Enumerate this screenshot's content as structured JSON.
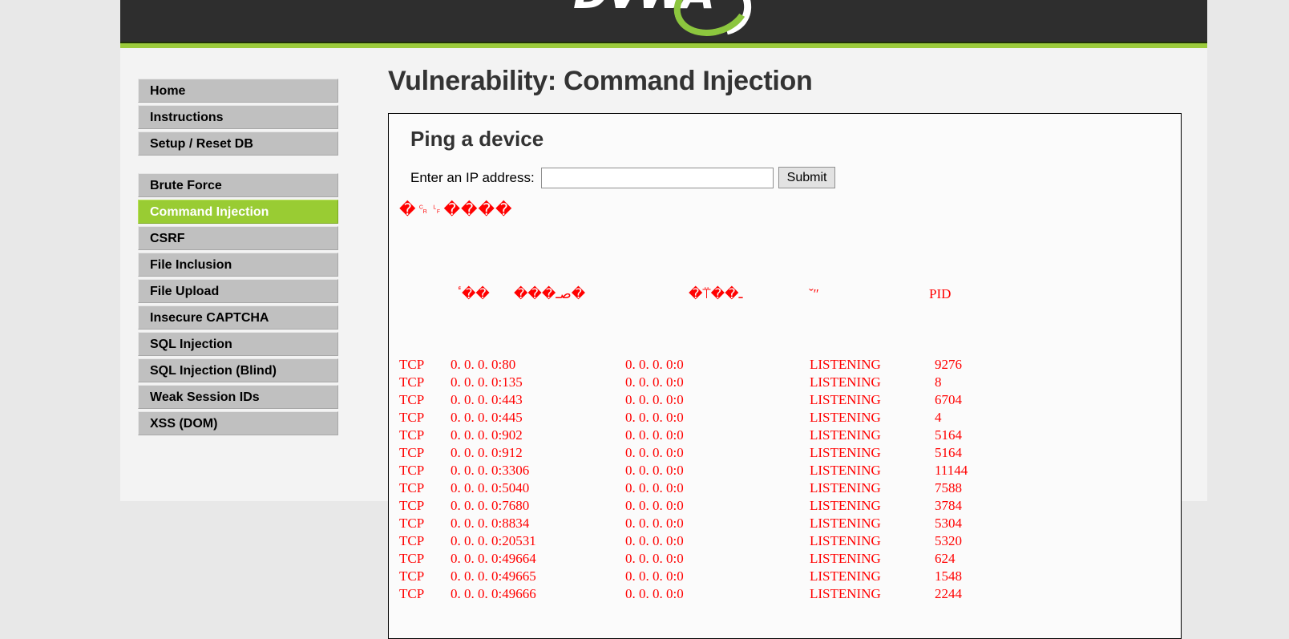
{
  "site": {
    "logo_text": "DVWA",
    "accent_green": "#9bcb3b",
    "header_dark": "#2e2e2e",
    "active_nav_green": "#9c3",
    "output_red": "#ff0000"
  },
  "sidebar": {
    "groups": [
      {
        "items": [
          {
            "label": "Home",
            "active": false
          },
          {
            "label": "Instructions",
            "active": false
          },
          {
            "label": "Setup / Reset DB",
            "active": false
          }
        ]
      },
      {
        "items": [
          {
            "label": "Brute Force",
            "active": false
          },
          {
            "label": "Command Injection",
            "active": true
          },
          {
            "label": "CSRF",
            "active": false
          },
          {
            "label": "File Inclusion",
            "active": false
          },
          {
            "label": "File Upload",
            "active": false
          },
          {
            "label": "Insecure CAPTCHA",
            "active": false
          },
          {
            "label": "SQL Injection",
            "active": false
          },
          {
            "label": "SQL Injection (Blind)",
            "active": false
          },
          {
            "label": "Weak Session IDs",
            "active": false
          },
          {
            "label": "XSS (DOM)",
            "active": false
          }
        ]
      }
    ]
  },
  "content": {
    "page_title": "Vulnerability: Command Injection",
    "box_title": "Ping a device",
    "form": {
      "label": "Enter an IP address:",
      "input_value": "",
      "input_placeholder": "",
      "submit_label": "Submit"
    },
    "mojibake_line": "�␍␊����",
    "output": {
      "header": {
        "proto": "ٴ��",
        "local": "���صـ�",
        "remote": "�⍡��ـ",
        "state": "ˇʺ",
        "pid": "PID"
      },
      "rows": [
        {
          "proto": "TCP",
          "local": "0. 0. 0. 0:80",
          "remote": "0. 0. 0. 0:0",
          "state": "LISTENING",
          "pid": "9276"
        },
        {
          "proto": "TCP",
          "local": "0. 0. 0. 0:135",
          "remote": "0. 0. 0. 0:0",
          "state": "LISTENING",
          "pid": "8"
        },
        {
          "proto": "TCP",
          "local": "0. 0. 0. 0:443",
          "remote": "0. 0. 0. 0:0",
          "state": "LISTENING",
          "pid": "6704"
        },
        {
          "proto": "TCP",
          "local": "0. 0. 0. 0:445",
          "remote": "0. 0. 0. 0:0",
          "state": "LISTENING",
          "pid": "4"
        },
        {
          "proto": "TCP",
          "local": "0. 0. 0. 0:902",
          "remote": "0. 0. 0. 0:0",
          "state": "LISTENING",
          "pid": "5164"
        },
        {
          "proto": "TCP",
          "local": "0. 0. 0. 0:912",
          "remote": "0. 0. 0. 0:0",
          "state": "LISTENING",
          "pid": "5164"
        },
        {
          "proto": "TCP",
          "local": "0. 0. 0. 0:3306",
          "remote": "0. 0. 0. 0:0",
          "state": "LISTENING",
          "pid": "11144"
        },
        {
          "proto": "TCP",
          "local": "0. 0. 0. 0:5040",
          "remote": "0. 0. 0. 0:0",
          "state": "LISTENING",
          "pid": "7588"
        },
        {
          "proto": "TCP",
          "local": "0. 0. 0. 0:7680",
          "remote": "0. 0. 0. 0:0",
          "state": "LISTENING",
          "pid": "3784"
        },
        {
          "proto": "TCP",
          "local": "0. 0. 0. 0:8834",
          "remote": "0. 0. 0. 0:0",
          "state": "LISTENING",
          "pid": "5304"
        },
        {
          "proto": "TCP",
          "local": "0. 0. 0. 0:20531",
          "remote": "0. 0. 0. 0:0",
          "state": "LISTENING",
          "pid": "5320"
        },
        {
          "proto": "TCP",
          "local": "0. 0. 0. 0:49664",
          "remote": "0. 0. 0. 0:0",
          "state": "LISTENING",
          "pid": "624"
        },
        {
          "proto": "TCP",
          "local": "0. 0. 0. 0:49665",
          "remote": "0. 0. 0. 0:0",
          "state": "LISTENING",
          "pid": "1548"
        },
        {
          "proto": "TCP",
          "local": "0. 0. 0. 0:49666",
          "remote": "0. 0. 0. 0:0",
          "state": "LISTENING",
          "pid": "2244"
        }
      ]
    }
  }
}
